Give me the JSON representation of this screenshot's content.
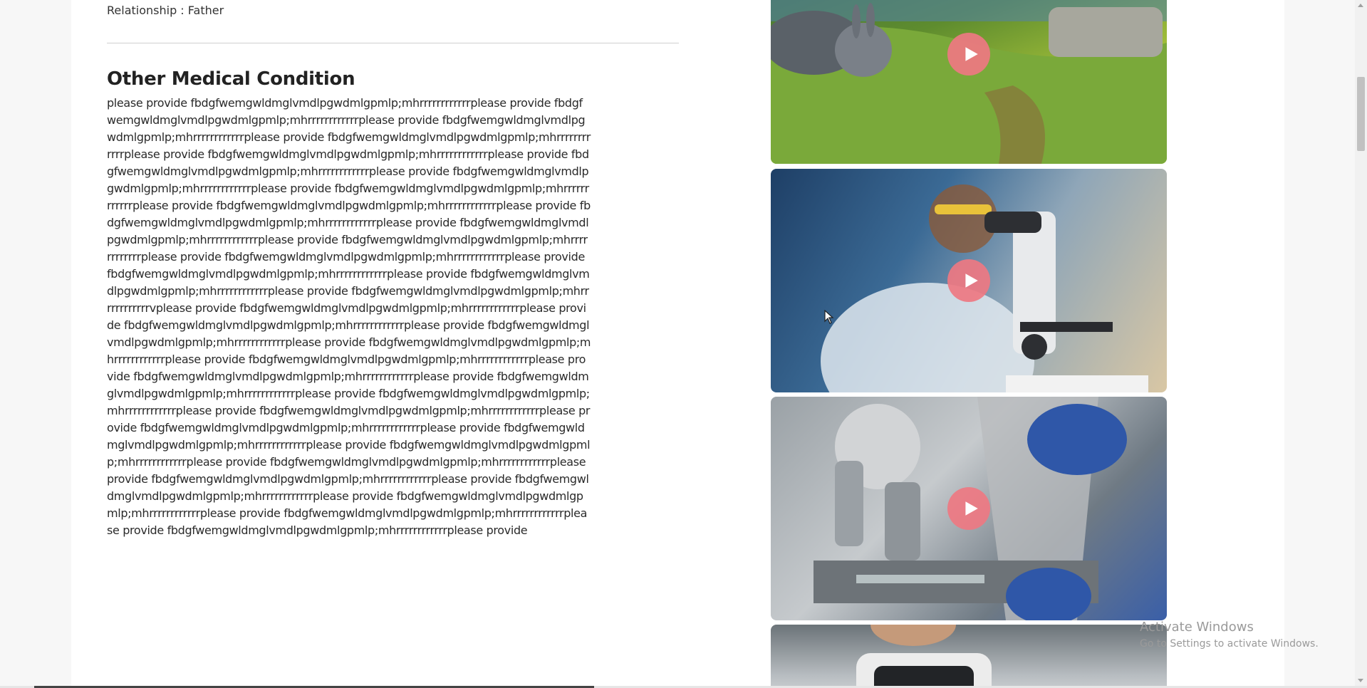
{
  "profile": {
    "relationship_label": "Relationship : Father"
  },
  "medical": {
    "section_title": "Other Medical Condition",
    "condition_text": "please provide fbdgfwemgwldmglvmdlpgwdmlgpmlp;mhrrrrrrrrrrrrplease provide fbdgfwemgwldmglvmdlpgwdmlgpmlp;mhrrrrrrrrrrrrplease provide fbdgfwemgwldmglvmdlpgwdmlgpmlp;mhrrrrrrrrrrrrplease provide fbdgfwemgwldmglvmdlpgwdmlgpmlp;mhrrrrrrrrrrrrplease provide fbdgfwemgwldmglvmdlpgwdmlgpmlp;mhrrrrrrrrrrrrplease provide fbdgfwemgwldmglvmdlpgwdmlgpmlp;mhrrrrrrrrrrrrplease provide fbdgfwemgwldmglvmdlpgwdmlgpmlp;mhrrrrrrrrrrrrplease provide fbdgfwemgwldmglvmdlpgwdmlgpmlp;mhrrrrrrrrrrrrplease provide fbdgfwemgwldmglvmdlpgwdmlgpmlp;mhrrrrrrrrrrrrplease provide fbdgfwemgwldmglvmdlpgwdmlgpmlp;mhrrrrrrrrrrrrplease provide fbdgfwemgwldmglvmdlpgwdmlgpmlp;mhrrrrrrrrrrrrplease provide fbdgfwemgwldmglvmdlpgwdmlgpmlp;mhrrrrrrrrrrrrplease provide fbdgfwemgwldmglvmdlpgwdmlgpmlp;mhrrrrrrrrrrrrplease provide fbdgfwemgwldmglvmdlpgwdmlgpmlp;mhrrrrrrrrrrrrplease provide fbdgfwemgwldmglvmdlpgwdmlgpmlp;mhrrrrrrrrrrrrplease provide fbdgfwemgwldmglvmdlpgwdmlgpmlp;mhrrrrrrrrrrrrvplease provide fbdgfwemgwldmglvmdlpgwdmlgpmlp;mhrrrrrrrrrrrrplease provide fbdgfwemgwldmglvmdlpgwdmlgpmlp;mhrrrrrrrrrrrrplease provide fbdgfwemgwldmglvmdlpgwdmlgpmlp;mhrrrrrrrrrrrrplease provide fbdgfwemgwldmglvmdlpgwdmlgpmlp;mhrrrrrrrrrrrrplease provide fbdgfwemgwldmglvmdlpgwdmlgpmlp;mhrrrrrrrrrrrrplease provide fbdgfwemgwldmglvmdlpgwdmlgpmlp;mhrrrrrrrrrrrrplease provide fbdgfwemgwldmglvmdlpgwdmlgpmlp;mhrrrrrrrrrrrrplease provide fbdgfwemgwldmglvmdlpgwdmlgpmlp;mhrrrrrrrrrrrrplease provide fbdgfwemgwldmglvmdlpgwdmlgpmlp;mhrrrrrrrrrrrrplease provide fbdgfwemgwldmglvmdlpgwdmlgpmlp;mhrrrrrrrrrrrrplease provide fbdgfwemgwldmglvmdlpgwdmlgpmlp;mhrrrrrrrrrrrrplease provide fbdgfwemgwldmglvmdlpgwdmlgpmlp;mhrrrrrrrrrrrrplease provide fbdgfwemgwldmglvmdlpgwdmlgpmlp;mhrrrrrrrrrrrrplease provide fbdgfwemgwldmglvmdlpgwdmlgpmlp;mhrrrrrrrrrrrrplease provide fbdgfwemgwldmglvmdlpgwdmlgpmlp;mhrrrrrrrrrrrrplease provide fbdgfwemgwldmglvmdlpgwdmlgpmlp;mhrrrrrrrrrrrrplease provide fbdgfwemgwldmglvmdlpgwdmlgpmlp;mhrrrrrrrrrrrrplease provide fbdgfwemgwldmglvmdlpgwdmlgpmlp;mhrrrrrrrrrrrrplease provide"
  },
  "videos": [
    {
      "icon": "play-icon",
      "scene": "animated rabbit on grassy hillside"
    },
    {
      "icon": "play-icon",
      "scene": "scientist looking into microscope"
    },
    {
      "icon": "play-icon",
      "scene": "microscope close-up with gloved hand"
    },
    {
      "icon": "play-icon",
      "scene": "person wearing VR headset"
    }
  ],
  "colors": {
    "play_button": "#ee7882",
    "background": "#f7f7f7",
    "card": "#ffffff"
  },
  "watermark": {
    "title": "Activate Windows",
    "subtitle": "Go to Settings to activate Windows."
  }
}
